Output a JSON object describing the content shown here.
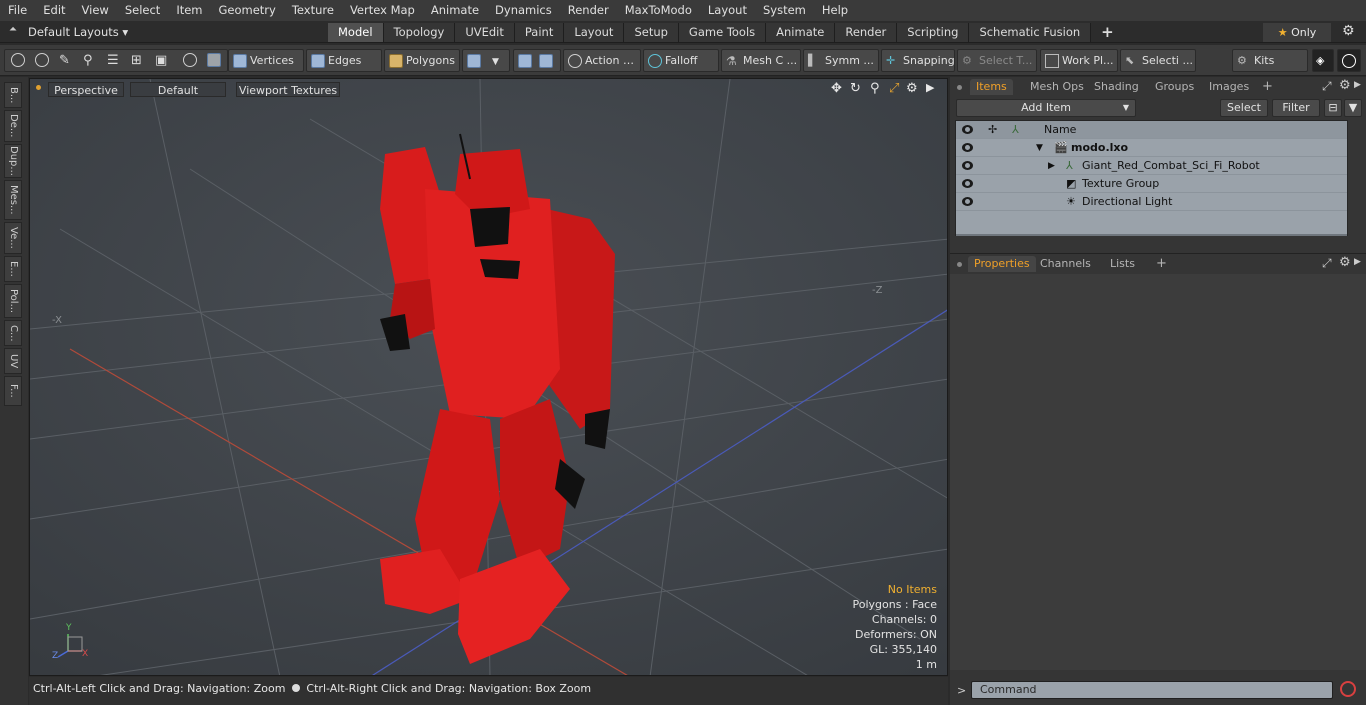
{
  "menubar": {
    "items": [
      "File",
      "Edit",
      "View",
      "Select",
      "Item",
      "Geometry",
      "Texture",
      "Vertex Map",
      "Animate",
      "Dynamics",
      "Render",
      "MaxToModo",
      "Layout",
      "System",
      "Help"
    ]
  },
  "layouts": {
    "label": "Default Layouts ▾"
  },
  "layout_tabs": [
    {
      "label": "Model",
      "active": true
    },
    {
      "label": "Topology"
    },
    {
      "label": "UVEdit"
    },
    {
      "label": "Paint"
    },
    {
      "label": "Layout"
    },
    {
      "label": "Setup"
    },
    {
      "label": "Game Tools"
    },
    {
      "label": "Animate"
    },
    {
      "label": "Render"
    },
    {
      "label": "Scripting"
    },
    {
      "label": "Schematic Fusion"
    }
  ],
  "only_label": "Only",
  "toolbar": {
    "vertices": "Vertices",
    "edges": "Edges",
    "polygons": "Polygons",
    "action": "Action",
    "falloff": "Falloff",
    "mesh": "Mesh C ...",
    "symm": "Symm ...",
    "snapping": "Snapping",
    "select_t": "Select T...",
    "work_pl": "Work Pl...",
    "selecti": "Selecti ...",
    "kits": "Kits"
  },
  "left_tabs": [
    "B...",
    "De...",
    "Dup...",
    "Mes...",
    "Ve...",
    "E...",
    "Pol...",
    "C...",
    "UV",
    "F..."
  ],
  "viewport": {
    "view": "Perspective",
    "shading": "Default",
    "textures": "Viewport Textures",
    "axis_neg_x": "-X",
    "axis_neg_z": "-Z",
    "stats": {
      "items": "No Items",
      "polygons": "Polygons : Face",
      "channels": "Channels: 0",
      "deformers": "Deformers: ON",
      "gl": "GL: 355,140",
      "scale": "1 m"
    },
    "gizmo": {
      "y": "Y",
      "z": "Z",
      "x": "X"
    }
  },
  "status": {
    "left": "Ctrl-Alt-Left Click and Drag: Navigation: Zoom",
    "right": "Ctrl-Alt-Right Click and Drag: Navigation: Box Zoom"
  },
  "items_panel": {
    "tabs": [
      {
        "label": "Items",
        "active": true
      },
      {
        "label": "Mesh Ops"
      },
      {
        "label": "Shading"
      },
      {
        "label": "Groups"
      },
      {
        "label": "Images"
      }
    ],
    "add_item": "Add Item",
    "select": "Select",
    "filter": "Filter",
    "name_header": "Name",
    "rows": [
      {
        "label": "modo.lxo",
        "bold": true
      },
      {
        "label": "Giant_Red_Combat_Sci_Fi_Robot"
      },
      {
        "label": "Texture Group"
      },
      {
        "label": "Directional Light"
      }
    ]
  },
  "properties_panel": {
    "tabs": [
      {
        "label": "Properties",
        "active": true
      },
      {
        "label": "Channels"
      },
      {
        "label": "Lists"
      }
    ]
  },
  "command": {
    "placeholder": "Command"
  }
}
